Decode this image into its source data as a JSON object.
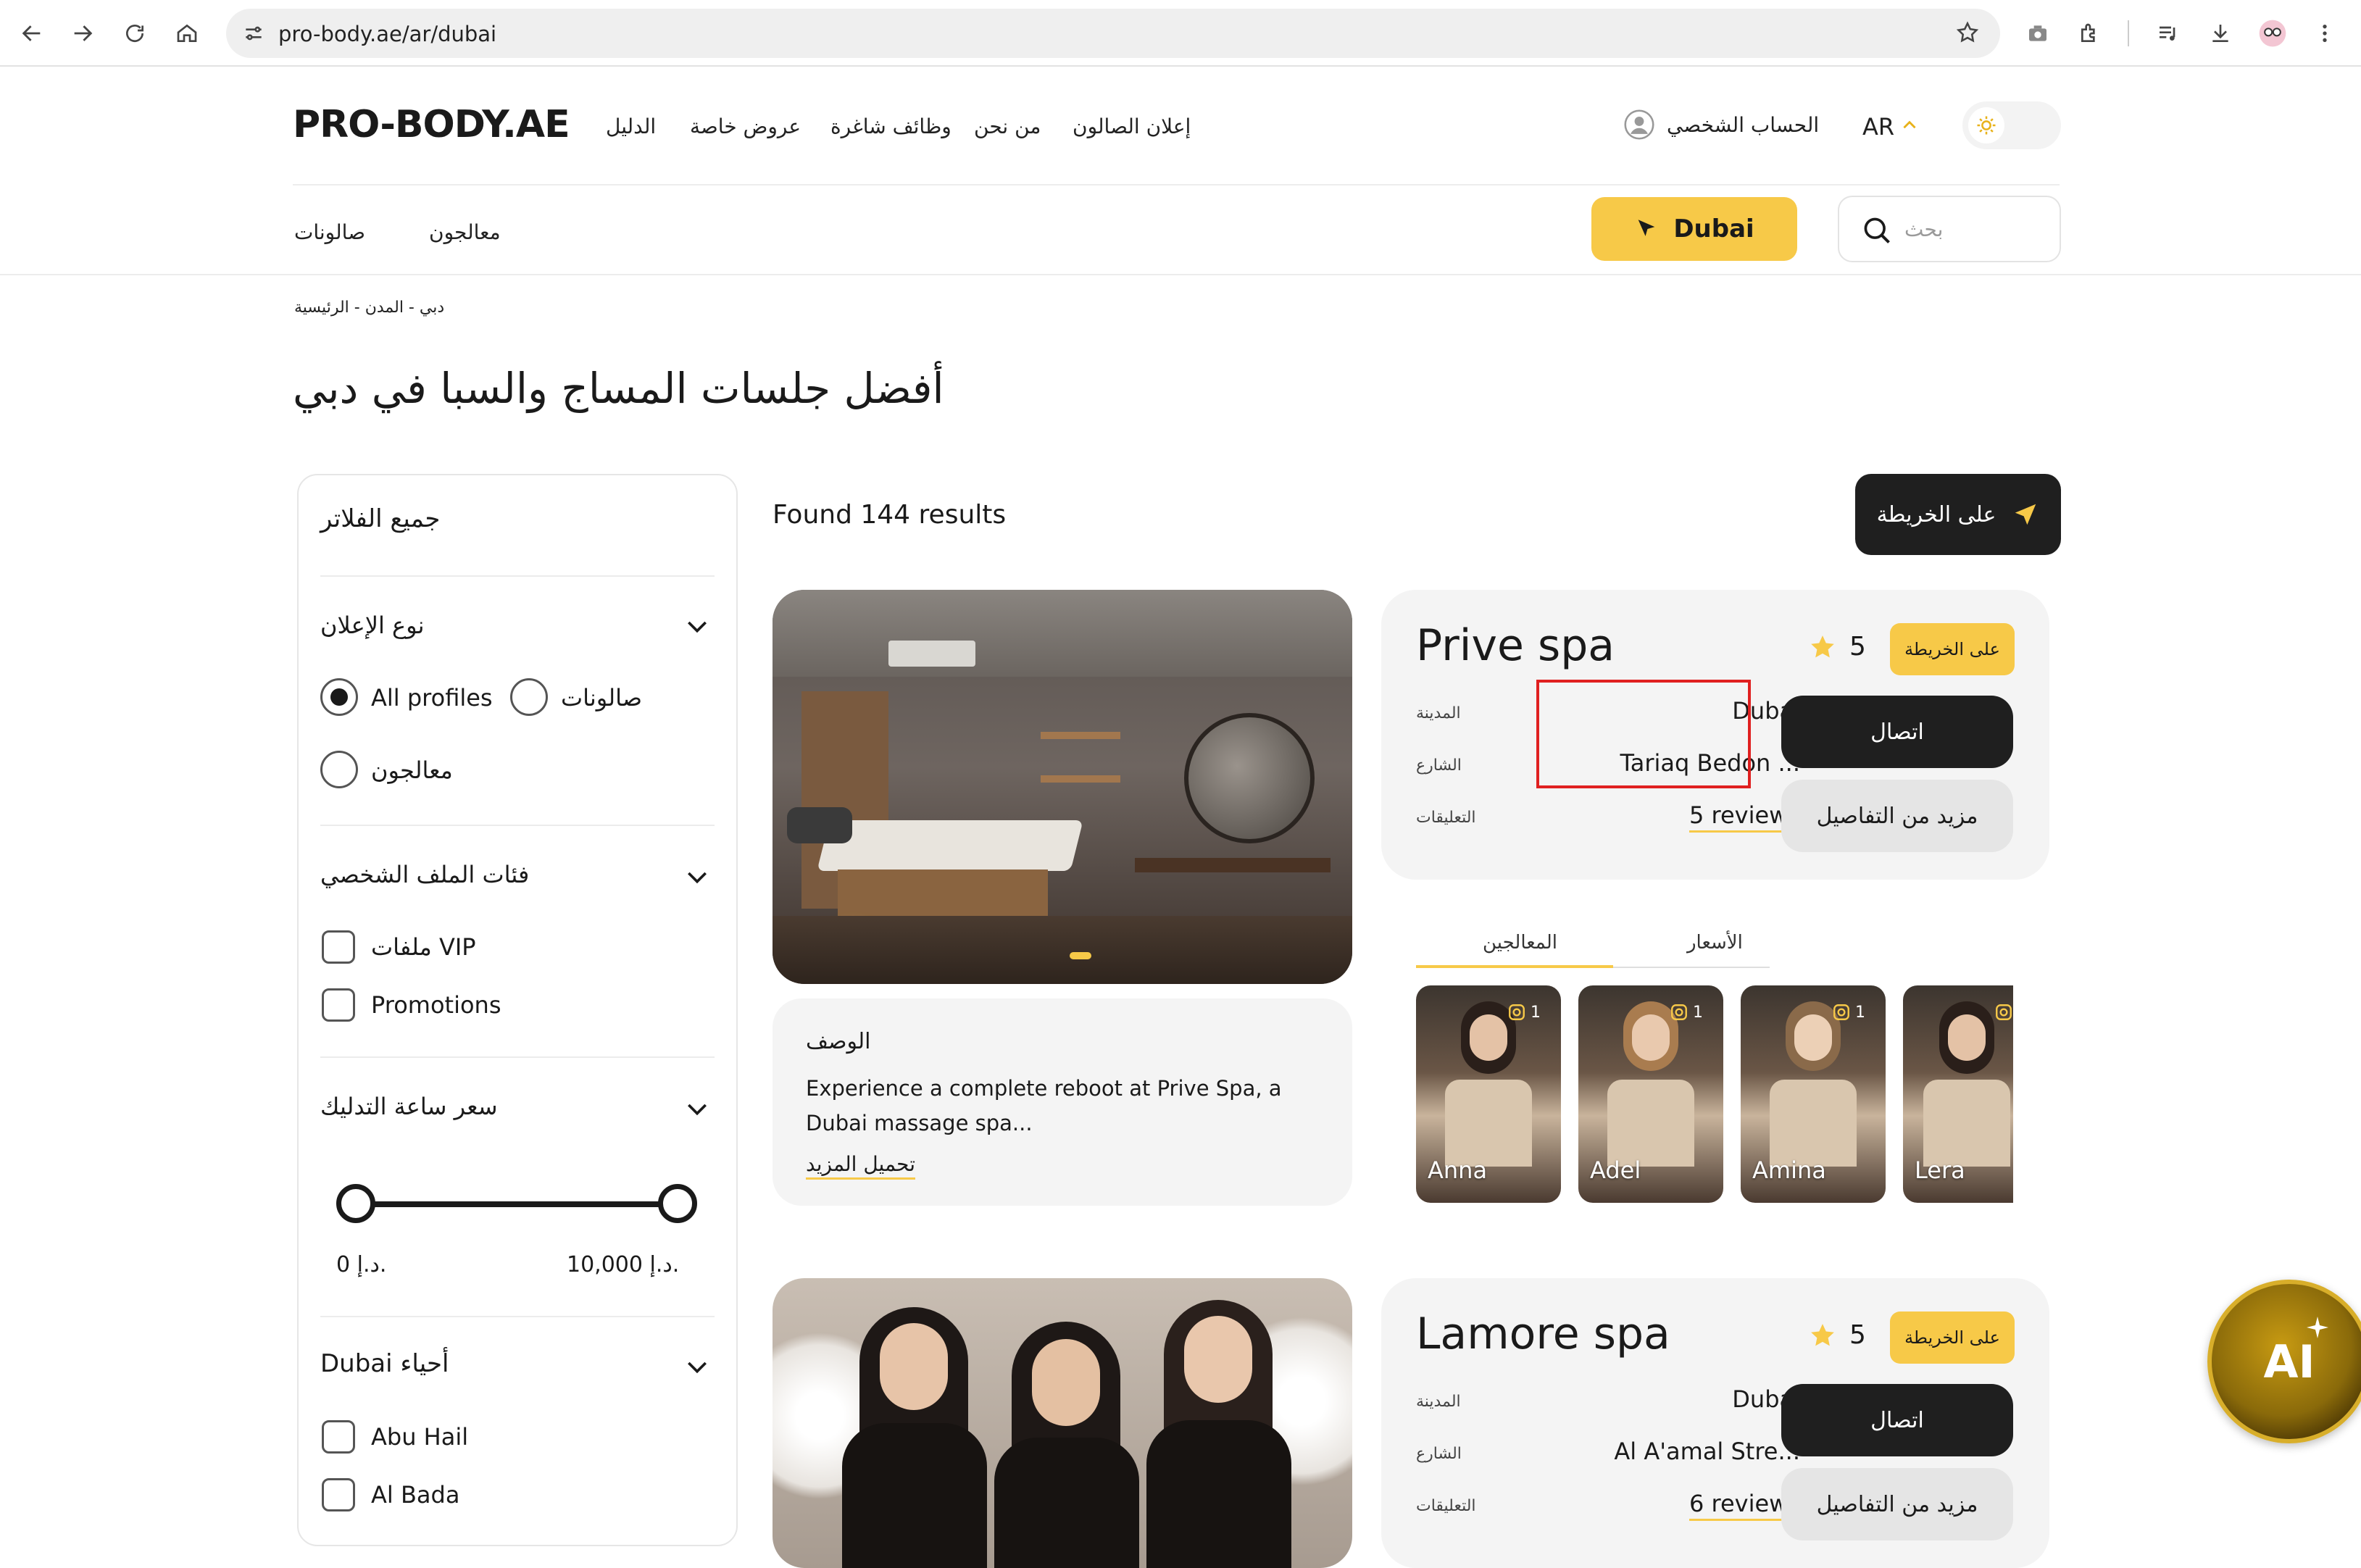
{
  "browser": {
    "url": "pro-body.ae/ar/dubai"
  },
  "header": {
    "logo": "PRO-BODY.AE",
    "nav": [
      "الدليل",
      "عروض خاصة",
      "وظائف شاغرة",
      "من نحن",
      "إعلان الصالون"
    ],
    "account": "الحساب الشخصي",
    "lang": "AR",
    "tabs": [
      "صالونات",
      "معالجون"
    ],
    "city_button": "Dubai",
    "search_placeholder": "بحث"
  },
  "breadcrumb": "دبي - المدن - الرئيسية",
  "page_title": "أفضل جلسات المساج والسبا في دبي",
  "filters": {
    "title": "جميع الفلاتر",
    "ad_type": {
      "title": "نوع الإعلان",
      "options": [
        {
          "label": "All profiles",
          "selected": true
        },
        {
          "label": "صالونات",
          "selected": false
        },
        {
          "label": "معالجون",
          "selected": false
        }
      ]
    },
    "categories": {
      "title": "فئات الملف الشخصي",
      "options": [
        "ملفات VIP",
        "Promotions"
      ]
    },
    "price": {
      "title": "سعر ساعة التدليك",
      "min_label": "0 د.إ.",
      "max_label": "10,000 د.إ."
    },
    "districts": {
      "title": "Dubai أحياء",
      "options": [
        "Abu Hail",
        "Al Bada"
      ]
    }
  },
  "results": {
    "found": "Found 144 results",
    "map_button": "على الخريطة",
    "cards": [
      {
        "name": "Prive spa",
        "rating": "5",
        "map_chip": "على الخريطة",
        "city_label": "المدينة",
        "city": "Dubai",
        "street_label": "الشارع",
        "street": "Tariaq Bedon ...",
        "reviews_label": "التعليقات",
        "reviews": "5 reviews",
        "call": "اتصال",
        "details": "مزيد من التفاصيل",
        "desc_title": "الوصف",
        "desc_text": "Experience a complete reboot at Prive Spa, a Dubai massage spa...",
        "load_more": "تحميل المزيد",
        "tabs": [
          "المعالجين",
          "الأسعار"
        ],
        "therapists": [
          {
            "name": "Anna",
            "badge": "1"
          },
          {
            "name": "Adel",
            "badge": "1"
          },
          {
            "name": "Amina",
            "badge": "1"
          },
          {
            "name": "Lera",
            "badge": ""
          }
        ]
      },
      {
        "name": "Lamore spa",
        "rating": "5",
        "map_chip": "على الخريطة",
        "city_label": "المدينة",
        "city": "Dubai",
        "street_label": "الشارع",
        "street": "Al A'amal Stre...",
        "reviews_label": "التعليقات",
        "reviews": "6 reviews",
        "call": "اتصال",
        "details": "مزيد من التفاصيل"
      }
    ]
  },
  "ai_button": "AI",
  "colors": {
    "accent": "#f7c948",
    "dark": "#1f1f1f",
    "card_bg": "#f4f4f4",
    "highlight_box": "#e02020"
  }
}
